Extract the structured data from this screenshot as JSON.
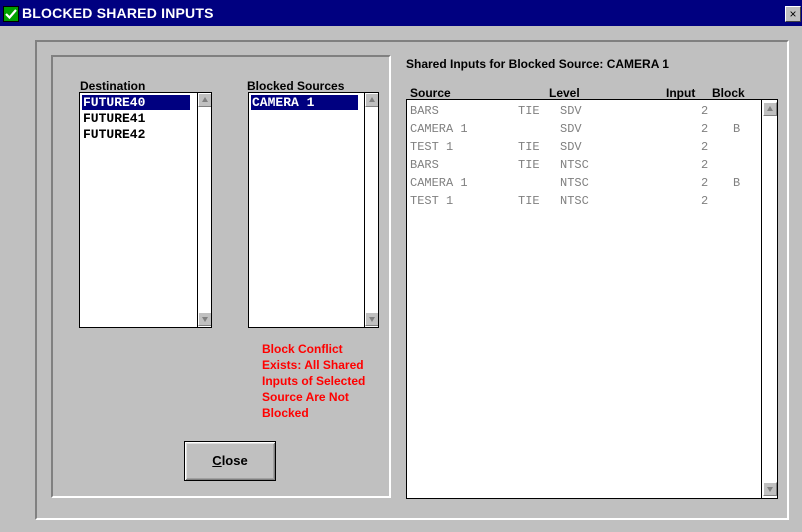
{
  "window": {
    "title": "BLOCKED SHARED INPUTS",
    "close_glyph": "×"
  },
  "destination": {
    "label": "Destination",
    "items": [
      "FUTURE40",
      "FUTURE41",
      "FUTURE42"
    ],
    "selected_index": 0
  },
  "blocked_sources": {
    "label": "Blocked Sources",
    "items": [
      "CAMERA 1"
    ],
    "selected_index": 0
  },
  "warning": [
    "Block Conflict",
    "Exists: All Shared",
    "Inputs of Selected",
    "Source Are Not",
    "Blocked"
  ],
  "close_button": {
    "label_prefix": "",
    "label_underlined": "C",
    "label_rest": "lose"
  },
  "shared": {
    "title": "Shared Inputs for Blocked Source: CAMERA 1",
    "headers": {
      "source": "Source",
      "level": "Level",
      "input": "Input",
      "block": "Block"
    },
    "rows": [
      {
        "source": "BARS",
        "tie": "TIE",
        "level": "SDV",
        "input": "2",
        "block": ""
      },
      {
        "source": "CAMERA 1",
        "tie": "",
        "level": "SDV",
        "input": "2",
        "block": "B"
      },
      {
        "source": "TEST 1",
        "tie": "TIE",
        "level": "SDV",
        "input": "2",
        "block": ""
      },
      {
        "source": "BARS",
        "tie": "TIE",
        "level": "NTSC",
        "input": "2",
        "block": ""
      },
      {
        "source": "CAMERA 1",
        "tie": "",
        "level": "NTSC",
        "input": "2",
        "block": "B"
      },
      {
        "source": "TEST 1",
        "tie": "TIE",
        "level": "NTSC",
        "input": "2",
        "block": ""
      }
    ]
  },
  "colors": {
    "title_bar": "#000080",
    "selection": "#000080",
    "warning": "#ff0000",
    "dim_text": "#808080",
    "face": "#c0c0c0"
  },
  "icons": {
    "app": "app-check-icon",
    "scroll_up": "scroll-up-arrow-icon",
    "scroll_down": "scroll-down-arrow-icon"
  }
}
